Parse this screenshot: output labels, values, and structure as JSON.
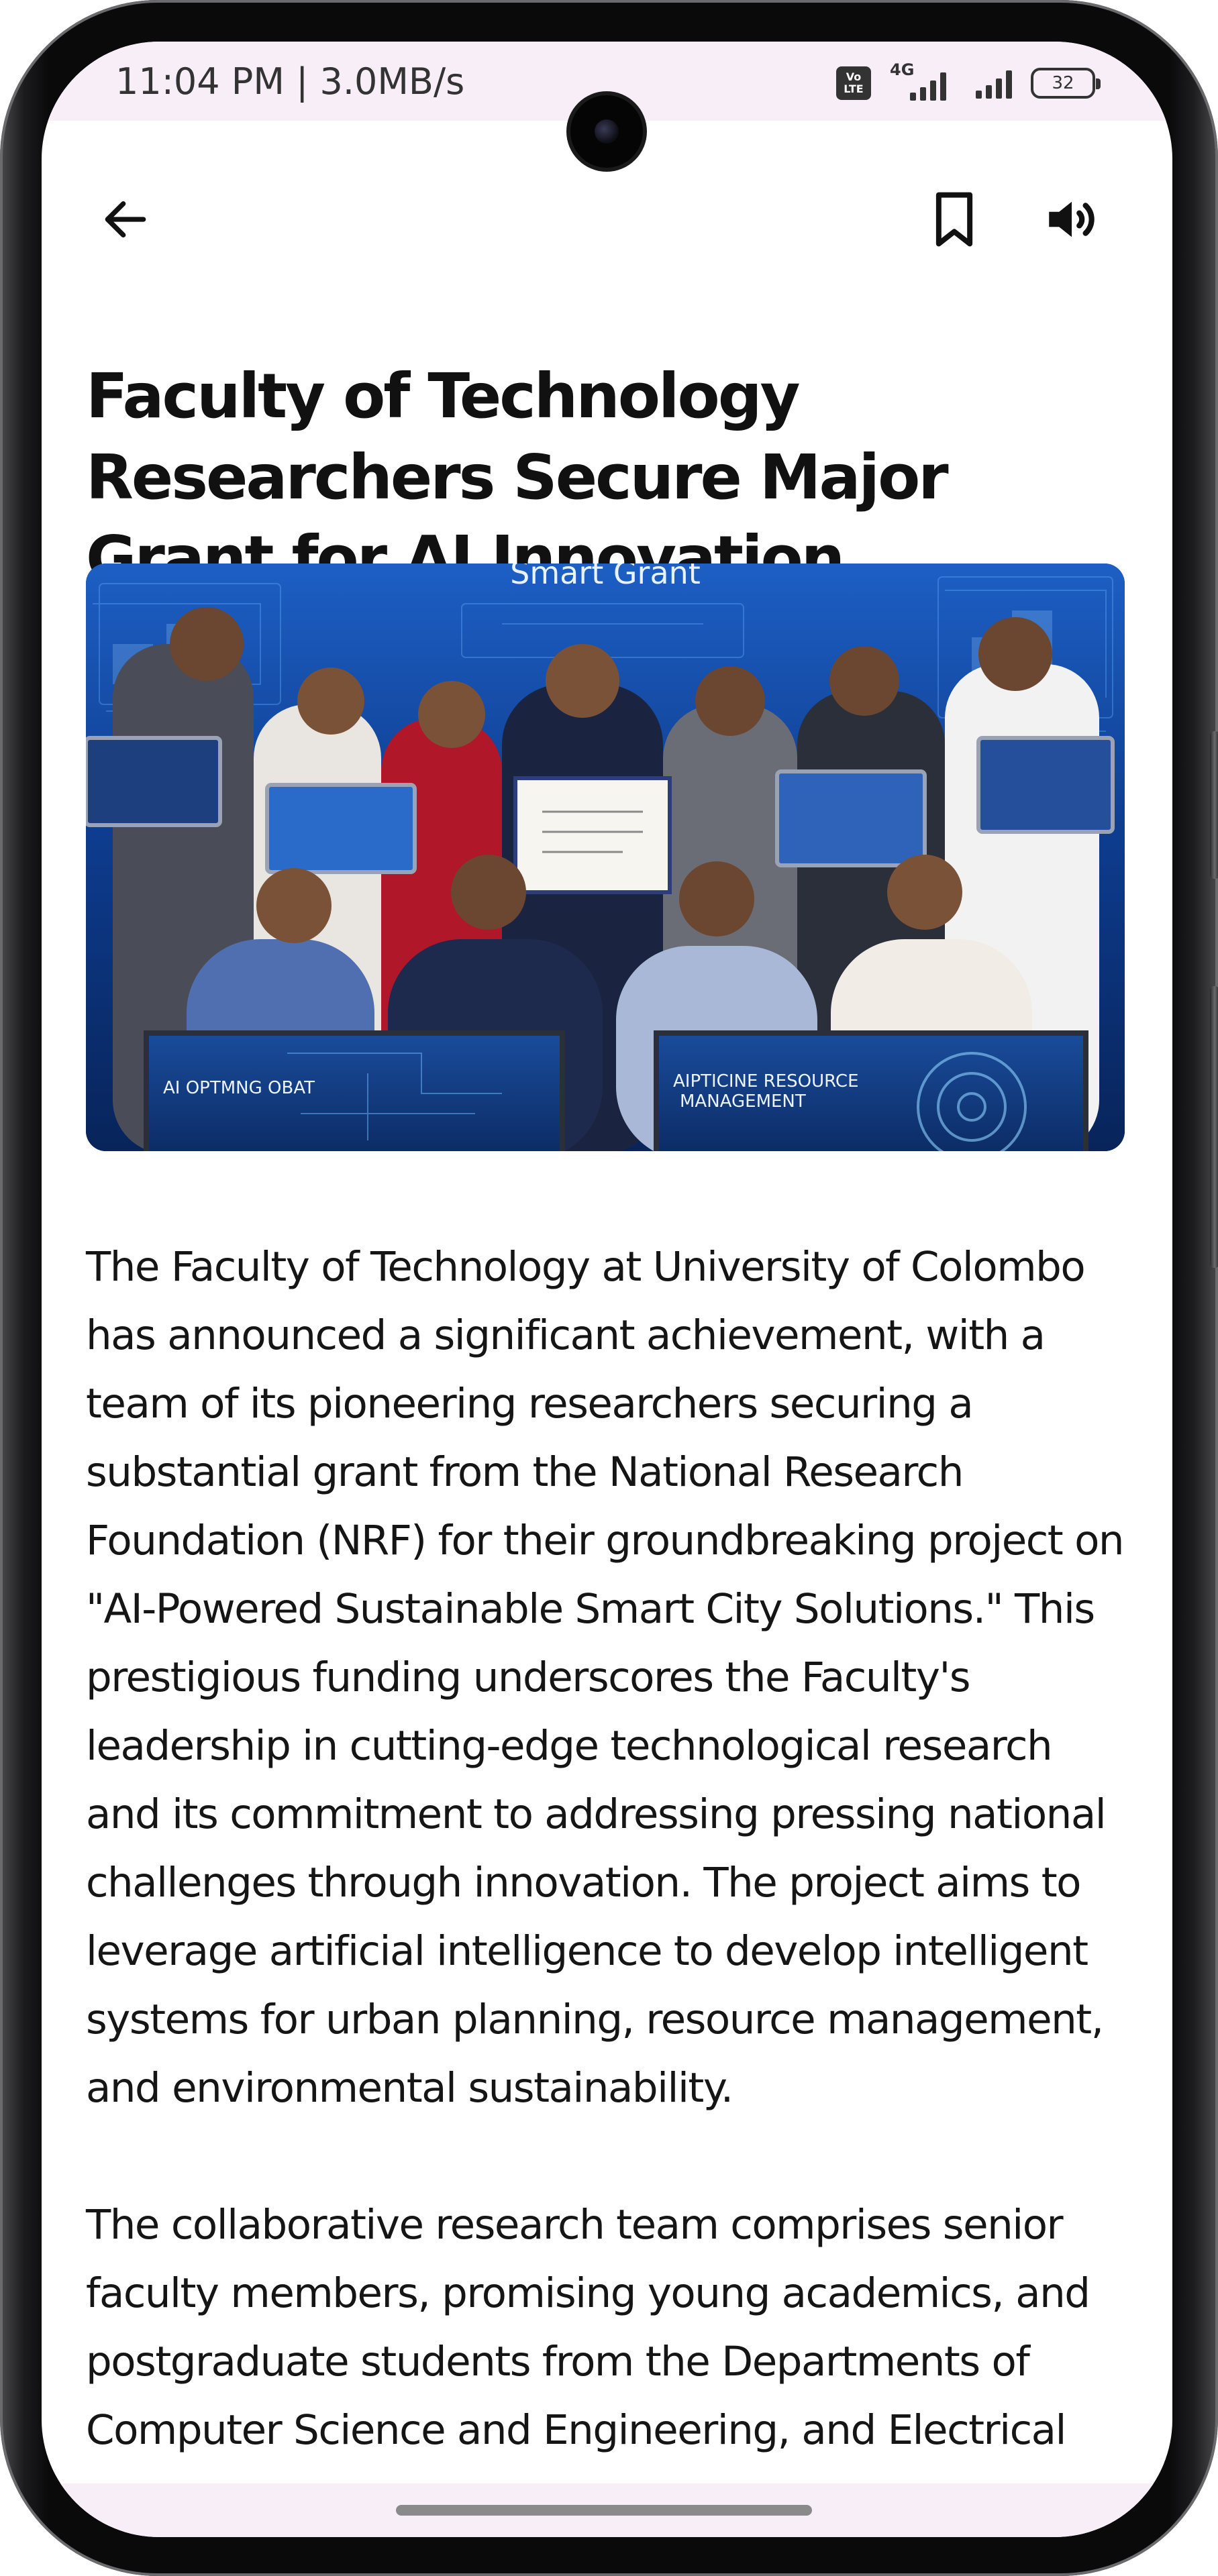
{
  "status_bar": {
    "time": "11:04 PM | 3.0MB/s",
    "volte_top": "Vo",
    "volte_bottom": "LTE",
    "network": "4G",
    "battery": "32"
  },
  "toolbar": {
    "back_icon": "arrow-left-icon",
    "bookmark_icon": "bookmark-icon",
    "audio_icon": "speaker-icon"
  },
  "article": {
    "title": "Faculty of Technology Researchers Secure Major Grant for AI Innovation",
    "image": {
      "banner_text": "Smart Grant",
      "left_sign": "AI OPTMNG OBAT",
      "right_sign_line1": "AIPTICINE RESOURCE",
      "right_sign_line2": "MANAGEMENT"
    },
    "paragraphs": [
      "The Faculty of Technology at University of Colombo has announced a significant achievement, with a team of its pioneering researchers securing a substantial grant from the National Research Foundation (NRF) for their groundbreaking project on \"AI-Powered Sustainable Smart City Solutions.\" This prestigious funding underscores the Faculty's leadership in cutting-edge technological research and its commitment to addressing pressing national challenges through innovation. The project aims to leverage artificial intelligence to develop intelligent systems for urban planning, resource management, and environmental sustainability.",
      "The collaborative research team comprises senior faculty members, promising young academics, and postgraduate students from the Departments of Computer Science and Engineering, and Electrical"
    ]
  },
  "colors": {
    "status_bar_bg": "#f8eef8",
    "text": "#151515",
    "image_blue": "#0a3c8f"
  }
}
